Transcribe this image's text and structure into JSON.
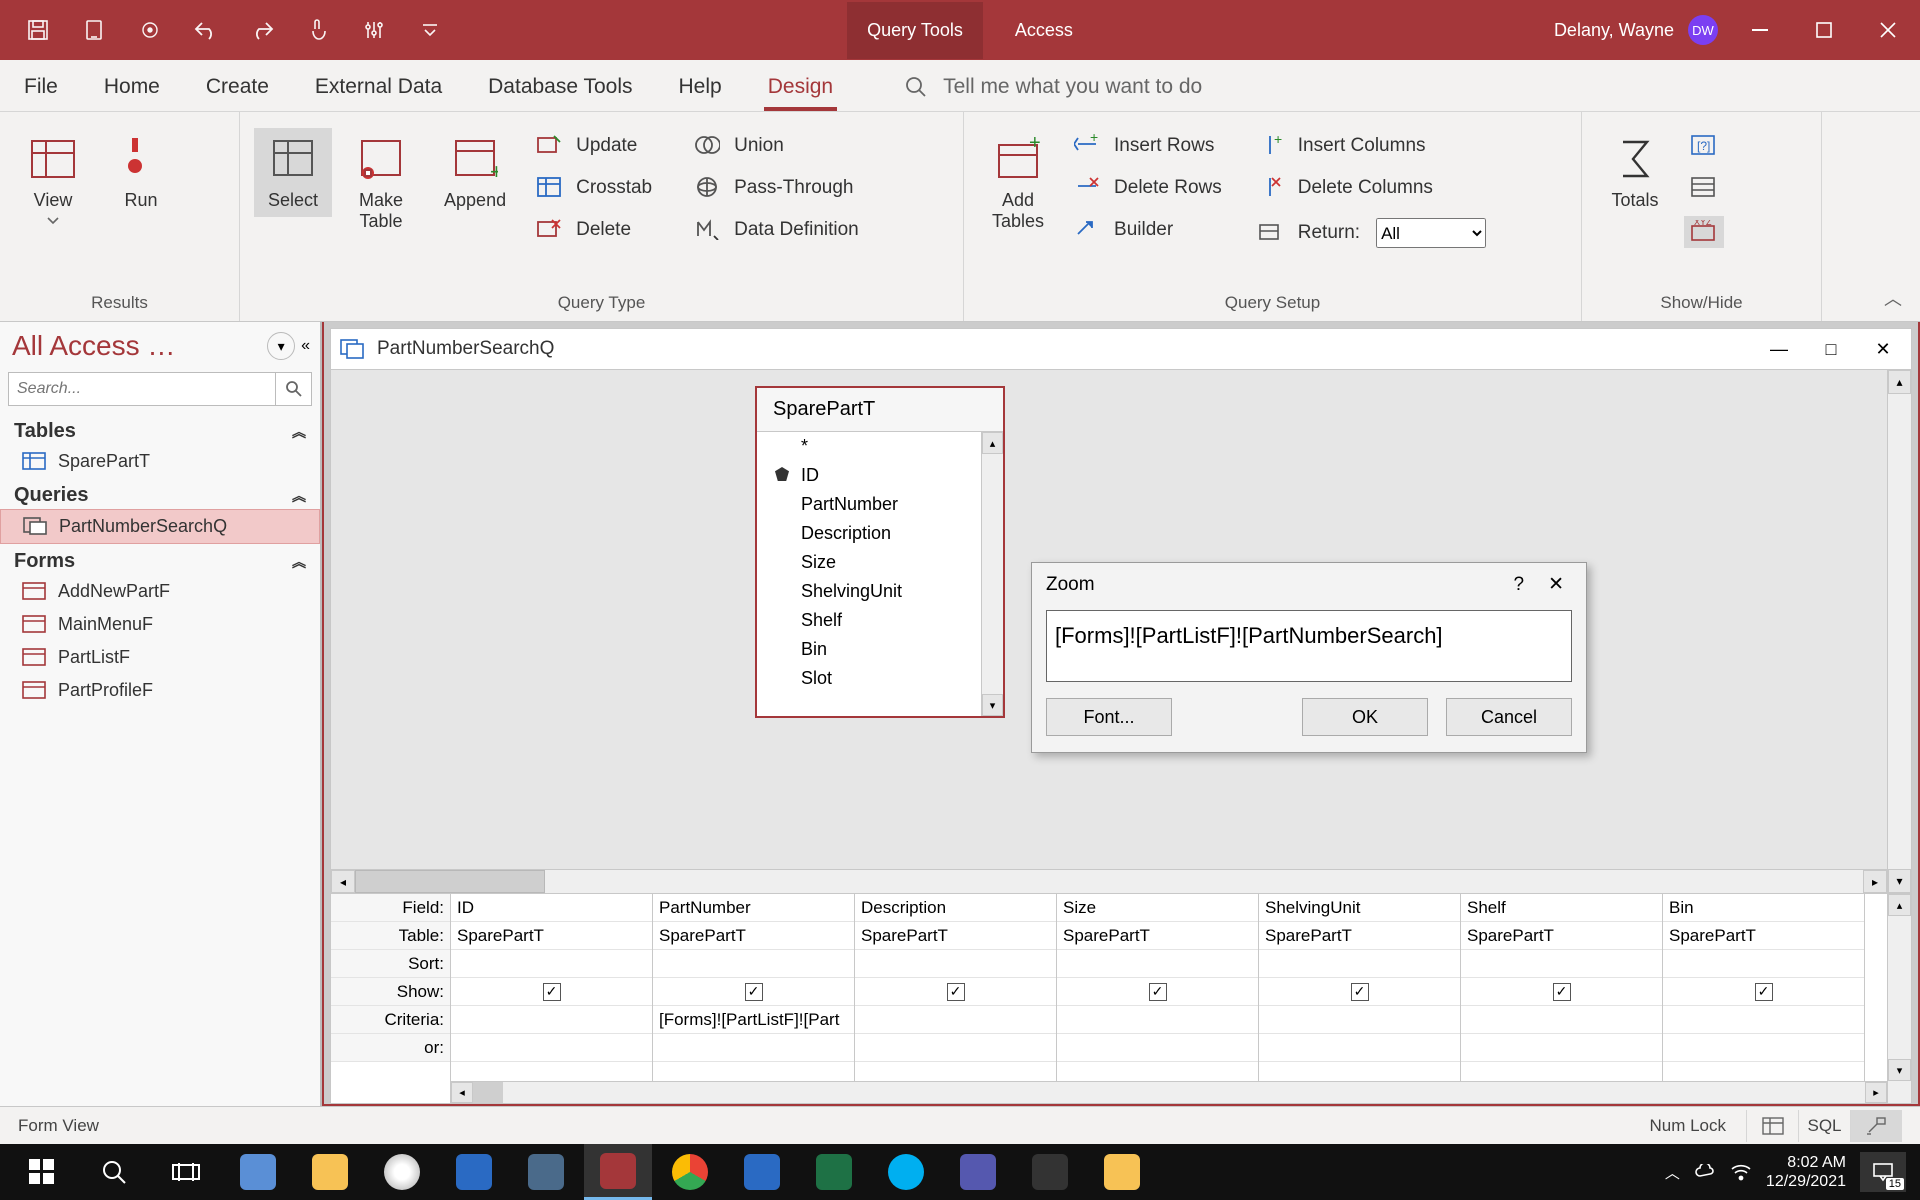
{
  "titlebar": {
    "tool_context": "Query Tools",
    "app_name": "Access",
    "user_name": "Delany, Wayne",
    "user_initials": "DW"
  },
  "tabs": {
    "file": "File",
    "home": "Home",
    "create": "Create",
    "external": "External Data",
    "dbtools": "Database Tools",
    "help": "Help",
    "design": "Design",
    "tellme": "Tell me what you want to do"
  },
  "ribbon": {
    "results": {
      "view": "View",
      "run": "Run",
      "label": "Results"
    },
    "qtype": {
      "select": "Select",
      "make": "Make\nTable",
      "append": "Append",
      "update": "Update",
      "crosstab": "Crosstab",
      "delete": "Delete",
      "union": "Union",
      "passthrough": "Pass-Through",
      "datadef": "Data Definition",
      "label": "Query Type"
    },
    "setup": {
      "addtables": "Add\nTables",
      "insrows": "Insert Rows",
      "delrows": "Delete Rows",
      "builder": "Builder",
      "inscols": "Insert Columns",
      "delcols": "Delete Columns",
      "return": "Return:",
      "return_val": "All",
      "label": "Query Setup"
    },
    "showhide": {
      "totals": "Totals",
      "label": "Show/Hide"
    }
  },
  "nav": {
    "title": "All Access …",
    "search_ph": "Search...",
    "cat_tables": "Tables",
    "cat_queries": "Queries",
    "cat_forms": "Forms",
    "tables": [
      "SparePartT"
    ],
    "queries": [
      "PartNumberSearchQ"
    ],
    "forms": [
      "AddNewPartF",
      "MainMenuF",
      "PartListF",
      "PartProfileF"
    ]
  },
  "doc": {
    "title": "PartNumberSearchQ",
    "table_name": "SparePartT",
    "fields": [
      "*",
      "ID",
      "PartNumber",
      "Description",
      "Size",
      "ShelvingUnit",
      "Shelf",
      "Bin",
      "Slot"
    ]
  },
  "zoom": {
    "title": "Zoom",
    "text": "[Forms]![PartListF]![PartNumberSearch]",
    "font": "Font...",
    "ok": "OK",
    "cancel": "Cancel"
  },
  "qbe": {
    "labels": {
      "field": "Field:",
      "table": "Table:",
      "sort": "Sort:",
      "show": "Show:",
      "criteria": "Criteria:",
      "or": "or:"
    },
    "cols": [
      {
        "field": "ID",
        "table": "SparePartT",
        "criteria": ""
      },
      {
        "field": "PartNumber",
        "table": "SparePartT",
        "criteria": "[Forms]![PartListF]![Part"
      },
      {
        "field": "Description",
        "table": "SparePartT",
        "criteria": ""
      },
      {
        "field": "Size",
        "table": "SparePartT",
        "criteria": ""
      },
      {
        "field": "ShelvingUnit",
        "table": "SparePartT",
        "criteria": ""
      },
      {
        "field": "Shelf",
        "table": "SparePartT",
        "criteria": ""
      },
      {
        "field": "Bin",
        "table": "SparePartT",
        "criteria": ""
      }
    ]
  },
  "status": {
    "left": "Form View",
    "numlock": "Num Lock",
    "sql": "SQL"
  },
  "tray": {
    "time": "8:02 AM",
    "date": "12/29/2021",
    "notif": "15"
  }
}
